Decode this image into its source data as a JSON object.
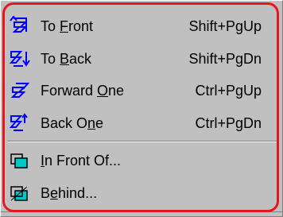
{
  "menu": {
    "items": [
      {
        "pre": "To ",
        "mnemonic": "F",
        "post": "ront",
        "shortcut": "Shift+PgUp",
        "icon": "bring-to-front-icon"
      },
      {
        "pre": "To ",
        "mnemonic": "B",
        "post": "ack",
        "shortcut": "Shift+PgDn",
        "icon": "send-to-back-icon"
      },
      {
        "pre": "Forward ",
        "mnemonic": "O",
        "post": "ne",
        "shortcut": "Ctrl+PgUp",
        "icon": "bring-forward-icon"
      },
      {
        "pre": "Back O",
        "mnemonic": "n",
        "post": "e",
        "shortcut": "Ctrl+PgDn",
        "icon": "send-backward-icon"
      },
      {
        "pre": "",
        "mnemonic": "I",
        "post": "n Front Of...",
        "shortcut": "",
        "icon": "in-front-of-icon"
      },
      {
        "pre": "B",
        "mnemonic": "e",
        "post": "hind...",
        "shortcut": "",
        "icon": "behind-icon"
      }
    ]
  },
  "colors": {
    "menu_background": "#c0c0c0",
    "icon_blue": "#0000ff",
    "icon_teal": "#00a0a0",
    "highlight_border": "#e8161a"
  }
}
